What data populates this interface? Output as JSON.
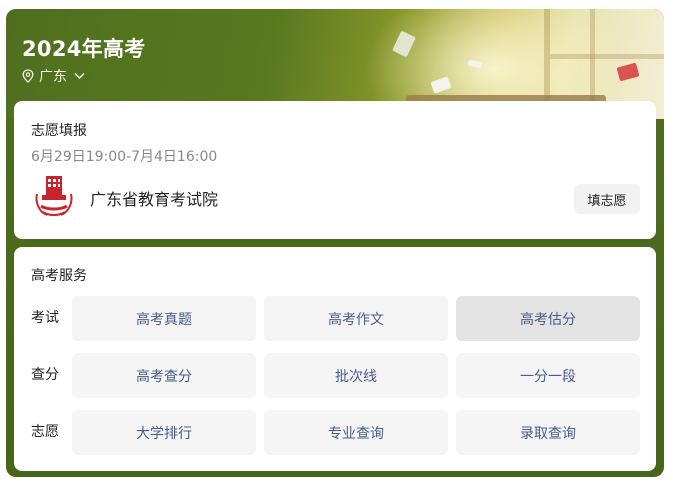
{
  "header": {
    "title": "2024年高考",
    "region": "广东"
  },
  "application": {
    "title": "志愿填报",
    "period": "6月29日19:00-7月4日16:00",
    "org_name": "广东省教育考试院",
    "button_label": "填志愿"
  },
  "services": {
    "title": "高考服务",
    "rows": [
      {
        "label": "考试",
        "items": [
          "高考真题",
          "高考作文",
          "高考估分"
        ]
      },
      {
        "label": "查分",
        "items": [
          "高考查分",
          "批次线",
          "一分一段"
        ]
      },
      {
        "label": "志愿",
        "items": [
          "大学排行",
          "专业查询",
          "录取查询"
        ]
      }
    ]
  },
  "colors": {
    "header_green": "#4f6e1e",
    "service_text": "#4a5a8a",
    "logo_red": "#c8242b"
  }
}
